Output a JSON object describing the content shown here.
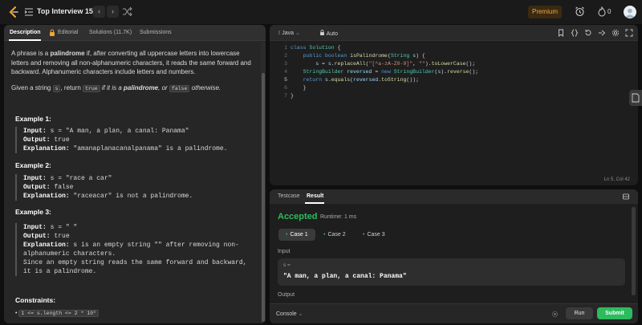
{
  "topbar": {
    "title": "Top Interview 150",
    "prev": "‹",
    "next": "›",
    "premium": "Premium",
    "streak_count": "0"
  },
  "tabs": {
    "description": "Description",
    "editorial": "Editorial",
    "solutions": "Solutions (11.7K)",
    "submissions": "Submissions"
  },
  "problem": {
    "p1_a": "A phrase is a ",
    "p1_bold": "palindrome",
    "p1_b": " if, after converting all uppercase letters into lowercase letters and removing all non-alphanumeric characters, it reads the same forward and backward. Alphanumeric characters include letters and numbers.",
    "p2_a": "Given a string ",
    "p2_code1": "s",
    "p2_b": ", return ",
    "p2_code2": "true",
    "p2_c": " if it is a ",
    "p2_bold": "palindrome",
    "p2_d": ", or ",
    "p2_code3": "false",
    "p2_e": " otherwise."
  },
  "examples": [
    {
      "title": "Example 1:",
      "input_label": "Input:",
      "input": " s = \"A man, a plan, a canal: Panama\"",
      "output_label": "Output:",
      "output": " true",
      "explanation_label": "Explanation:",
      "explanation": " \"amanaplanacanalpanama\" is a palindrome."
    },
    {
      "title": "Example 2:",
      "input_label": "Input:",
      "input": " s = \"race a car\"",
      "output_label": "Output:",
      "output": " false",
      "explanation_label": "Explanation:",
      "explanation": " \"raceacar\" is not a palindrome."
    },
    {
      "title": "Example 3:",
      "input_label": "Input:",
      "input": " s = \" \"",
      "output_label": "Output:",
      "output": " true",
      "explanation_label": "Explanation:",
      "explanation": " s is an empty string \"\" after removing non-alphanumeric characters.",
      "explanation2": "Since an empty string reads the same forward and backward, it is a palindrome."
    }
  ],
  "constraints": {
    "title": "Constraints:",
    "item1": "1 <= s.length <= 2 * 10⁵"
  },
  "editor": {
    "language": "Java",
    "mode": "Auto",
    "line_numbers": [
      "1",
      "2",
      "3",
      "4",
      "5",
      "6",
      "7"
    ],
    "cursor": "Ln 5, Col 42"
  },
  "result": {
    "tab_testcase": "Testcase",
    "tab_result": "Result",
    "status": "Accepted",
    "runtime": "Runtime: 1 ms",
    "cases": [
      "Case 1",
      "Case 2",
      "Case 3"
    ],
    "input_label": "Input",
    "input_var": "s =",
    "input_value": "\"A man, a plan, a canal: Panama\"",
    "output_label": "Output",
    "console": "Console",
    "run": "Run",
    "submit": "Submit"
  },
  "colors": {
    "accepted": "#2cbb5d",
    "premium": "#f3a536"
  }
}
